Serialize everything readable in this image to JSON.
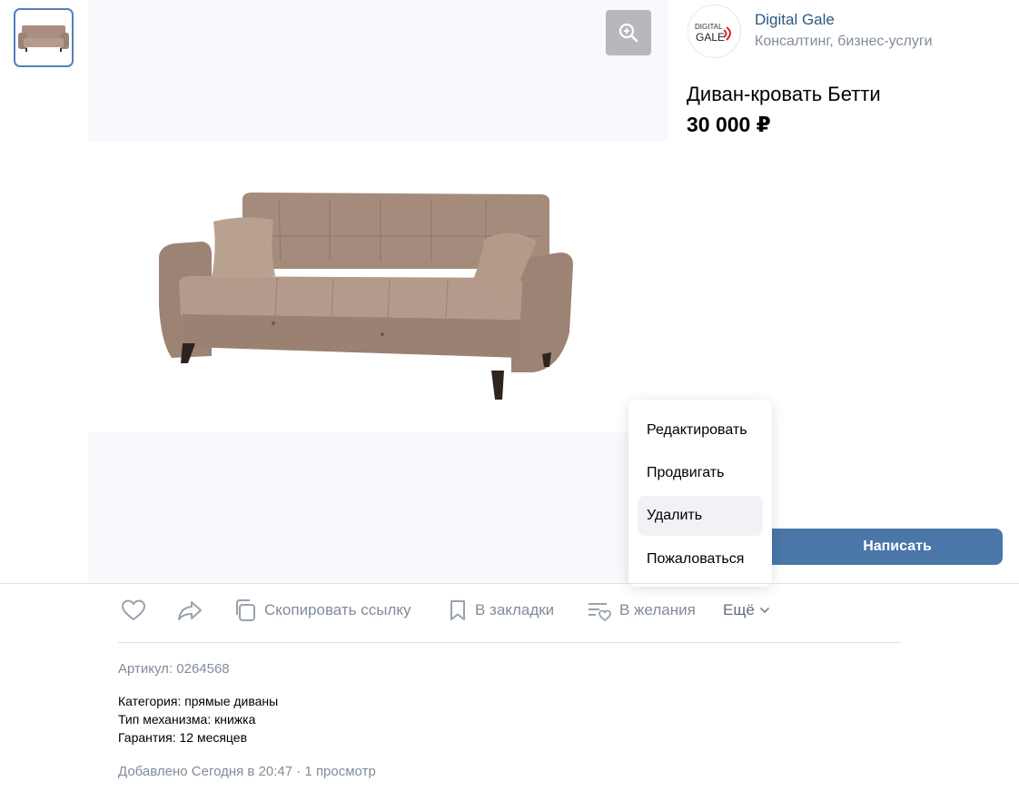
{
  "shop": {
    "name": "Digital Gale",
    "category": "Консалтинг, бизнес-услуги",
    "logo_text_top": "DIGITAL",
    "logo_text_bottom": "GALE"
  },
  "product": {
    "title": "Диван-кровать Бетти",
    "price": "30 000 ₽"
  },
  "menu": {
    "items": [
      {
        "label": "Редактировать"
      },
      {
        "label": "Продвигать"
      },
      {
        "label": "Удалить"
      },
      {
        "label": "Пожаловаться"
      }
    ],
    "highlighted_index": 2
  },
  "write_button": {
    "label": "Написать"
  },
  "actions": {
    "like_icon": "heart-icon",
    "share_icon": "share-arrow-icon",
    "copy_link": "Скопировать ссылку",
    "bookmark": "В закладки",
    "wishlist": "В желания",
    "more": "Ещё"
  },
  "details": {
    "sku": "Артикул: 0264568",
    "properties": [
      "Категория: прямые диваны",
      "Тип механизма: книжка",
      "Гарантия: 12 месяцев"
    ],
    "meta": "Добавлено Сегодня в 20:47 · 1 просмотр"
  },
  "colors": {
    "accent": "#4a76a8",
    "link": "#2a5885",
    "muted": "#818c99",
    "sofa": "#a88f80"
  }
}
